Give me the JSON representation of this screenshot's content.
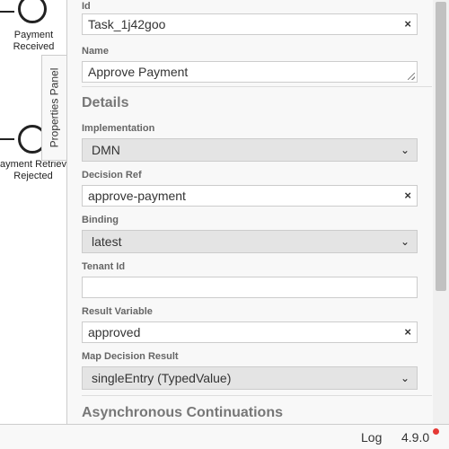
{
  "canvas": {
    "events": [
      {
        "label_line1": "Payment",
        "label_line2": "Received"
      },
      {
        "label_line1": "ayment Retriev",
        "label_line2": "Rejected"
      }
    ]
  },
  "panel_toggle": {
    "label": "Properties Panel"
  },
  "form": {
    "id": {
      "label": "Id",
      "value": "Task_1j42goo",
      "clear": "×"
    },
    "name": {
      "label": "Name",
      "value": "Approve Payment"
    },
    "details_title": "Details",
    "implementation": {
      "label": "Implementation",
      "value": "DMN"
    },
    "decision_ref": {
      "label": "Decision Ref",
      "value": "approve-payment",
      "clear": "×"
    },
    "binding": {
      "label": "Binding",
      "value": "latest"
    },
    "tenant_id": {
      "label": "Tenant Id",
      "value": ""
    },
    "result_variable": {
      "label": "Result Variable",
      "value": "approved",
      "clear": "×"
    },
    "map_decision_result": {
      "label": "Map Decision Result",
      "value": "singleEntry (TypedValue)"
    },
    "async_title": "Asynchronous Continuations",
    "chevron": "⌄"
  },
  "footer": {
    "log": "Log",
    "version": "4.9.0"
  },
  "colors": {
    "notification_dot": "#e53935"
  }
}
